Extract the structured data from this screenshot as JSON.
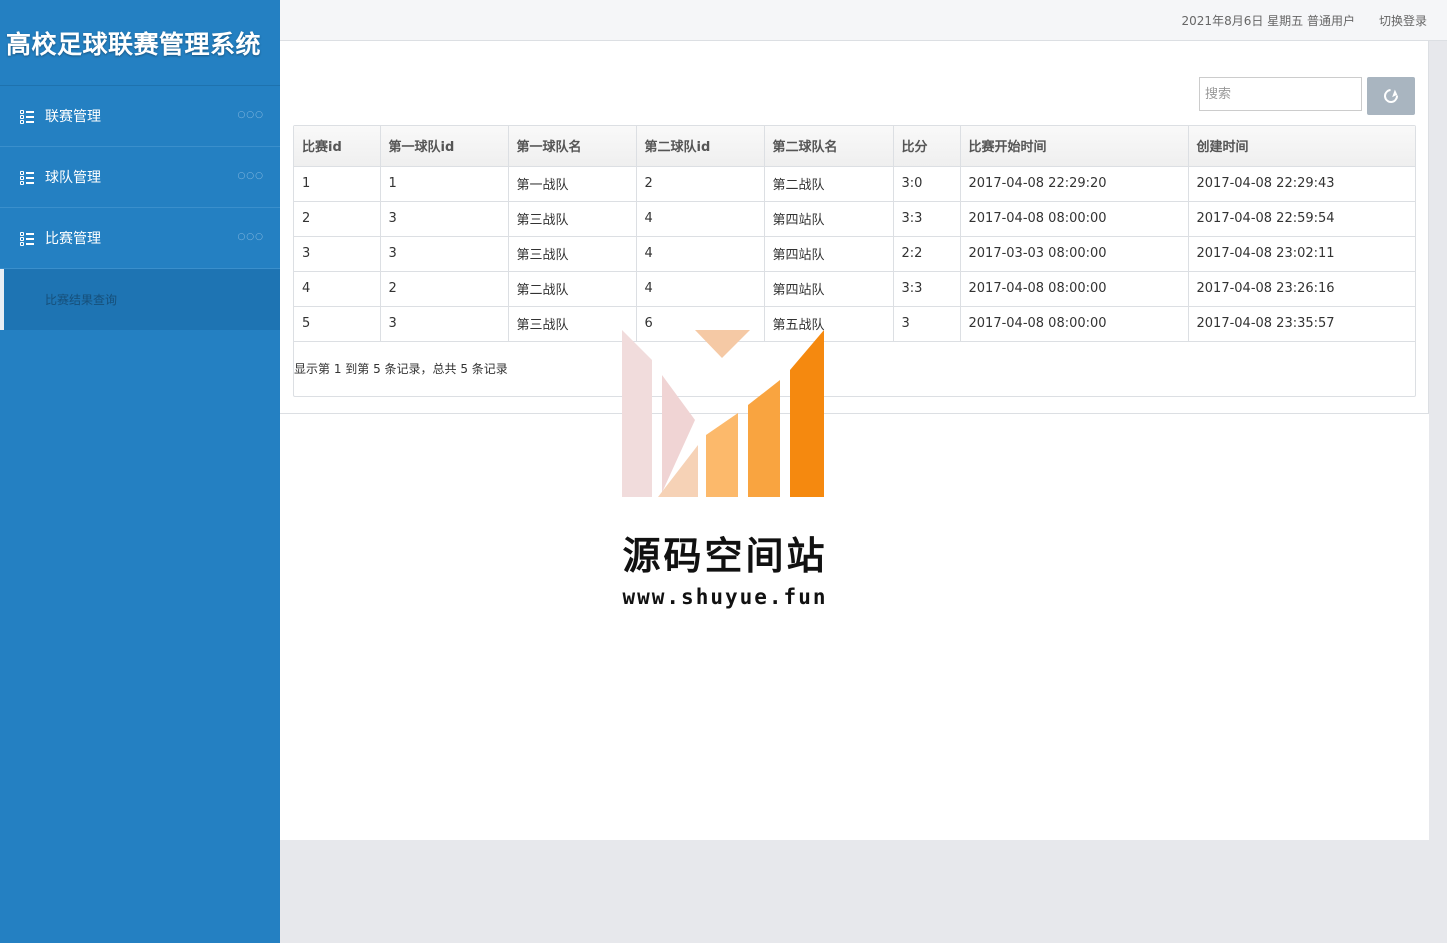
{
  "app": {
    "title": "高校足球联赛管理系统"
  },
  "sidebar": {
    "items": [
      {
        "label": "联赛管理",
        "dots": "○○○"
      },
      {
        "label": "球队管理",
        "dots": "○○○"
      },
      {
        "label": "比赛管理",
        "dots": "○○○"
      }
    ],
    "sub_items": [
      {
        "label": "比赛结果查询"
      }
    ]
  },
  "topbar": {
    "date": "2021年8月6日 星期五 普通用户",
    "logout": "切换登录"
  },
  "search": {
    "placeholder": "搜索"
  },
  "table": {
    "headers": [
      "比赛id",
      "第一球队id",
      "第一球队名",
      "第二球队id",
      "第二球队名",
      "比分",
      "比赛开始时间",
      "创建时间"
    ],
    "rows": [
      [
        "1",
        "1",
        "第一战队",
        "2",
        "第二战队",
        "3:0",
        "2017-04-08 22:29:20",
        "2017-04-08 22:29:43"
      ],
      [
        "2",
        "3",
        "第三战队",
        "4",
        "第四站队",
        "3:3",
        "2017-04-08 08:00:00",
        "2017-04-08 22:59:54"
      ],
      [
        "3",
        "3",
        "第三战队",
        "4",
        "第四站队",
        "2:2",
        "2017-03-03 08:00:00",
        "2017-04-08 23:02:11"
      ],
      [
        "4",
        "2",
        "第二战队",
        "4",
        "第四站队",
        "3:3",
        "2017-04-08 08:00:00",
        "2017-04-08 23:26:16"
      ],
      [
        "5",
        "3",
        "第三战队",
        "6",
        "第五战队",
        "3",
        "2017-04-08 08:00:00",
        "2017-04-08 23:35:57"
      ]
    ]
  },
  "pagination": {
    "info": "显示第 1 到第 5 条记录，总共 5 条记录"
  },
  "watermark": {
    "name": "源码空间站",
    "url": "www.shuyue.fun"
  },
  "colors": {
    "sidebar": "#2480c2",
    "sidebar_active": "#1e74b3",
    "refresh_button": "#a9b5c0",
    "logo_orange": "#f5890f"
  }
}
